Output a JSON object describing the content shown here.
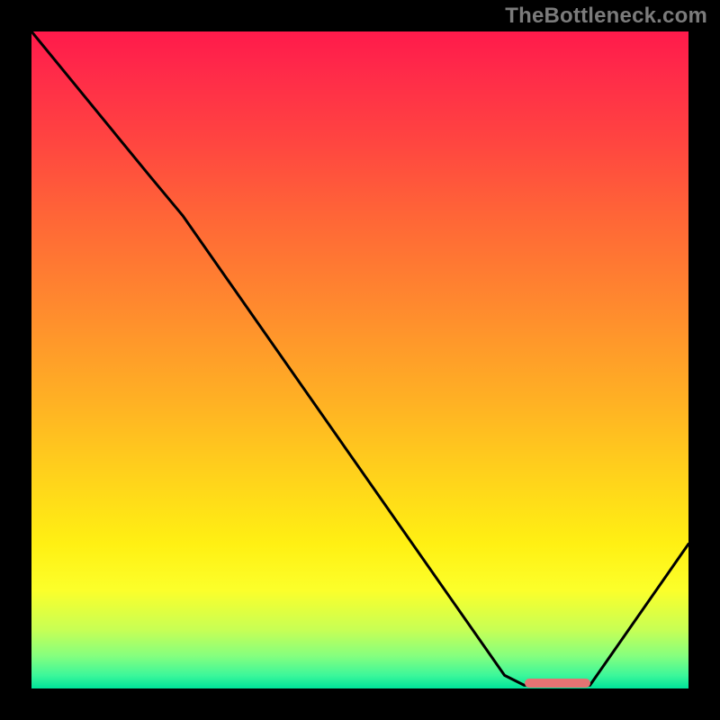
{
  "watermark": "TheBottleneck.com",
  "chart_data": {
    "type": "line",
    "x_range": [
      0,
      100
    ],
    "y_range": [
      0,
      100
    ],
    "curve": [
      {
        "x": 0,
        "y": 100
      },
      {
        "x": 18,
        "y": 78
      },
      {
        "x": 23,
        "y": 72
      },
      {
        "x": 72,
        "y": 2
      },
      {
        "x": 75,
        "y": 0.5
      },
      {
        "x": 85,
        "y": 0.5
      },
      {
        "x": 100,
        "y": 22
      }
    ],
    "marker": {
      "x_start": 75,
      "x_end": 85,
      "y": 0.8
    },
    "gradient_stops": [
      {
        "pos": 0,
        "color": "#ff1a4b"
      },
      {
        "pos": 50,
        "color": "#ffb024"
      },
      {
        "pos": 80,
        "color": "#fff013"
      },
      {
        "pos": 100,
        "color": "#00e49a"
      }
    ],
    "title": "",
    "xlabel": "",
    "ylabel": ""
  }
}
